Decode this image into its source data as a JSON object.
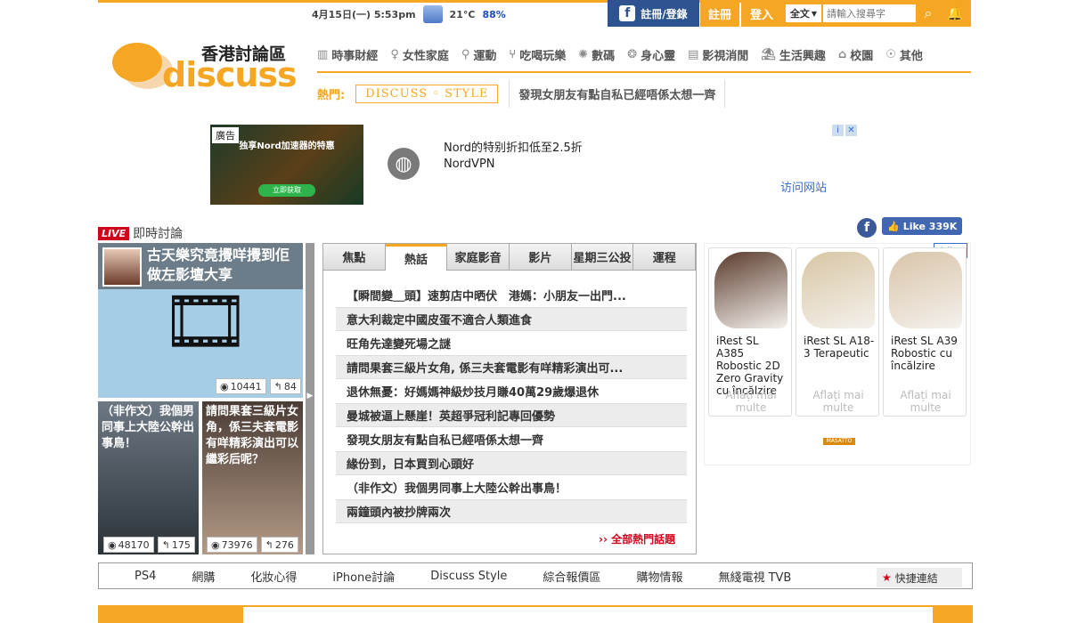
{
  "header": {
    "date_time": "4月15日(一) 5:53pm",
    "temperature": "21°C",
    "humidity": "88%",
    "facebook_login": "註冊/登錄",
    "register": "註冊",
    "login": "登入",
    "search_scope": "全文",
    "search_placeholder": "請輸入搜尋字"
  },
  "logo": {
    "chinese": "香港討論區",
    "word": "discuss"
  },
  "nav": {
    "items": [
      {
        "label": "時事財經",
        "icon": "building-icon"
      },
      {
        "label": "女性家庭",
        "icon": "woman-icon"
      },
      {
        "label": "運動",
        "icon": "running-icon"
      },
      {
        "label": "吃喝玩樂",
        "icon": "utensils-icon"
      },
      {
        "label": "數碼",
        "icon": "chip-icon"
      },
      {
        "label": "身心靈",
        "icon": "mandala-icon"
      },
      {
        "label": "影視消閒",
        "icon": "film-icon"
      },
      {
        "label": "生活興趣",
        "icon": "lamp-icon"
      },
      {
        "label": "校園",
        "icon": "graduation-icon"
      },
      {
        "label": "其他",
        "icon": "antenna-icon"
      }
    ]
  },
  "hot": {
    "label": "熱門:",
    "style_tag": "DISCUSS ◦ STYLE",
    "topic": "發現女朋友有點自私已經唔係太想一齊"
  },
  "ad": {
    "tag": "廣告",
    "image_text": "独享Nord加速器的特惠",
    "image_button": "立即获取",
    "title": "Nord的特别折扣低至2.5折",
    "brand": "NordVPN",
    "visit": "访问网站"
  },
  "live": {
    "badge": "LIVE",
    "title": "即時討論",
    "fb_like": "Like 339K"
  },
  "tiles": {
    "main": {
      "title": "古天樂究竟攪咩攪到佢做左影壇大享",
      "views": "10441",
      "replies": "84"
    },
    "a": {
      "title": "（非作文）我個男同事上大陸公幹出事鳥！",
      "views": "48170",
      "replies": "175"
    },
    "b": {
      "title": "請問果套三級片女角，係三夫套電影有咩精彩演出可以繼彩后呢？",
      "views": "73976",
      "replies": "276"
    }
  },
  "tabs": [
    "焦點",
    "熱話",
    "家庭影音",
    "影片",
    "星期三公投",
    "運程"
  ],
  "active_tab": "熱話",
  "hot_list": [
    "【瞬間變＿頭】速剪店中晒伏　港媽：小朋友一出門...",
    "意大利裁定中國皮蛋不適合人類進食",
    "旺角先達變死場之謎",
    "請問果套三級片女角, 係三夫套電影有咩精彩演出可...",
    "退休無憂：好媽媽神級炒技月賺40萬29歲爆退休",
    "曼城被逼上懸崖！英超爭冠利記專回優勢",
    "發現女朋友有點自私已經唔係太想一齊",
    "緣份到，日本買到心頭好",
    "（非作文）我個男同事上大陸公幹出事鳥！",
    "兩鐘頭內被抄牌兩次"
  ],
  "more_link": "›› 全部熱門話題",
  "right_ad": {
    "tag": "廣告",
    "products": [
      {
        "name": "iRest SL A385 Robostic 2D Zero Gravity cu încălzire",
        "cta": "Aflați mai multe",
        "color": "#5a3a2c"
      },
      {
        "name": "iRest SL A18-3 Terapeutic",
        "cta": "Aflați mai multe",
        "color": "#d8c6a4"
      },
      {
        "name": "iRest SL A39 Robostic cu încălzire",
        "cta": "Aflați mai multe",
        "color": "#d9c4a9"
      }
    ],
    "logo": "MASATTO"
  },
  "quick_links": [
    "PS4",
    "網購",
    "化妝心得",
    "iPhone討論",
    "Discuss Style",
    "綜合報價區",
    "購物情報",
    "無綫電視 TVB"
  ],
  "quick_link_button": "快捷連結"
}
